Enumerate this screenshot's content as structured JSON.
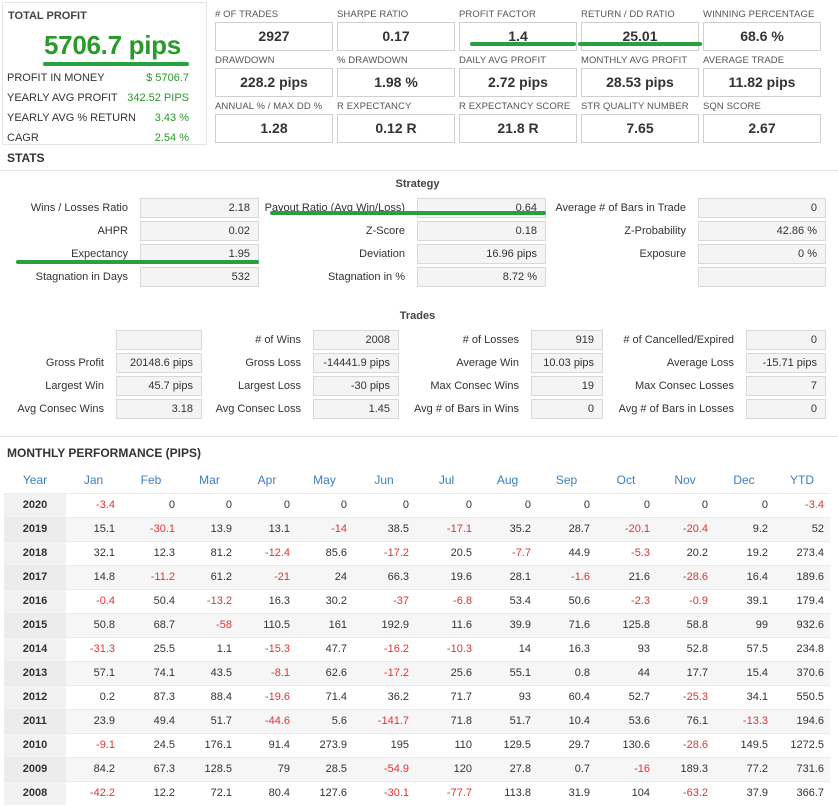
{
  "summary": {
    "total_profit_label": "TOTAL PROFIT",
    "total_profit_value": "5706.7 pips",
    "rows": [
      {
        "label": "PROFIT IN MONEY",
        "value": "$ 5706.7"
      },
      {
        "label": "YEARLY AVG PROFIT",
        "value": "342.52 PIPS"
      },
      {
        "label": "YEARLY AVG % RETURN",
        "value": "3.43 %"
      },
      {
        "label": "CAGR",
        "value": "2.54 %"
      }
    ]
  },
  "metrics": [
    {
      "label": "# OF TRADES",
      "value": "2927"
    },
    {
      "label": "SHARPE RATIO",
      "value": "0.17"
    },
    {
      "label": "PROFIT FACTOR",
      "value": "1.4"
    },
    {
      "label": "RETURN / DD RATIO",
      "value": "25.01"
    },
    {
      "label": "WINNING PERCENTAGE",
      "value": "68.6 %"
    },
    {
      "label": "DRAWDOWN",
      "value": "228.2 pips"
    },
    {
      "label": "% DRAWDOWN",
      "value": "1.98 %"
    },
    {
      "label": "DAILY AVG PROFIT",
      "value": "2.72 pips"
    },
    {
      "label": "MONTHLY AVG PROFIT",
      "value": "28.53 pips"
    },
    {
      "label": "AVERAGE TRADE",
      "value": "11.82 pips"
    },
    {
      "label": "ANNUAL % / MAX DD %",
      "value": "1.28"
    },
    {
      "label": "R EXPECTANCY",
      "value": "0.12 R"
    },
    {
      "label": "R EXPECTANCY SCORE",
      "value": "21.8 R"
    },
    {
      "label": "STR QUALITY NUMBER",
      "value": "7.65"
    },
    {
      "label": "SQN SCORE",
      "value": "2.67"
    }
  ],
  "stats": {
    "title": "STATS",
    "strategy_title": "Strategy",
    "strategy": [
      [
        {
          "label": "Wins / Losses Ratio",
          "value": "2.18"
        },
        {
          "label": "Payout Ratio (Avg Win/Loss)",
          "value": "0.64"
        },
        {
          "label": "Average # of Bars in Trade",
          "value": "0"
        }
      ],
      [
        {
          "label": "AHPR",
          "value": "0.02"
        },
        {
          "label": "Z-Score",
          "value": "0.18"
        },
        {
          "label": "Z-Probability",
          "value": "42.86 %"
        }
      ],
      [
        {
          "label": "Expectancy",
          "value": "1.95"
        },
        {
          "label": "Deviation",
          "value": "16.96 pips"
        },
        {
          "label": "Exposure",
          "value": "0 %"
        }
      ],
      [
        {
          "label": "Stagnation in Days",
          "value": "532"
        },
        {
          "label": "Stagnation in %",
          "value": "8.72 %"
        },
        {
          "label": "",
          "value": ""
        }
      ]
    ],
    "trades_title": "Trades",
    "trades": [
      [
        {
          "label": "",
          "value": ""
        },
        {
          "label": "# of Wins",
          "value": "2008"
        },
        {
          "label": "# of Losses",
          "value": "919"
        },
        {
          "label": "# of Cancelled/Expired",
          "value": "0"
        }
      ],
      [
        {
          "label": "Gross Profit",
          "value": "20148.6 pips"
        },
        {
          "label": "Gross Loss",
          "value": "-14441.9 pips"
        },
        {
          "label": "Average Win",
          "value": "10.03 pips"
        },
        {
          "label": "Average Loss",
          "value": "-15.71 pips"
        }
      ],
      [
        {
          "label": "Largest Win",
          "value": "45.7 pips"
        },
        {
          "label": "Largest Loss",
          "value": "-30 pips"
        },
        {
          "label": "Max Consec Wins",
          "value": "19"
        },
        {
          "label": "Max Consec Losses",
          "value": "7"
        }
      ],
      [
        {
          "label": "Avg Consec Wins",
          "value": "3.18"
        },
        {
          "label": "Avg Consec Loss",
          "value": "1.45"
        },
        {
          "label": "Avg # of Bars in Wins",
          "value": "0"
        },
        {
          "label": "Avg # of Bars in Losses",
          "value": "0"
        }
      ]
    ]
  },
  "monthly": {
    "title": "MONTHLY PERFORMANCE (PIPS)",
    "headers": [
      "Year",
      "Jan",
      "Feb",
      "Mar",
      "Apr",
      "May",
      "Jun",
      "Jul",
      "Aug",
      "Sep",
      "Oct",
      "Nov",
      "Dec",
      "YTD"
    ],
    "rows": [
      [
        "2020",
        "-3.4",
        "0",
        "0",
        "0",
        "0",
        "0",
        "0",
        "0",
        "0",
        "0",
        "0",
        "0",
        "-3.4"
      ],
      [
        "2019",
        "15.1",
        "-30.1",
        "13.9",
        "13.1",
        "-14",
        "38.5",
        "-17.1",
        "35.2",
        "28.7",
        "-20.1",
        "-20.4",
        "9.2",
        "52"
      ],
      [
        "2018",
        "32.1",
        "12.3",
        "81.2",
        "-12.4",
        "85.6",
        "-17.2",
        "20.5",
        "-7.7",
        "44.9",
        "-5.3",
        "20.2",
        "19.2",
        "273.4"
      ],
      [
        "2017",
        "14.8",
        "-11.2",
        "61.2",
        "-21",
        "24",
        "66.3",
        "19.6",
        "28.1",
        "-1.6",
        "21.6",
        "-28.6",
        "16.4",
        "189.6"
      ],
      [
        "2016",
        "-0.4",
        "50.4",
        "-13.2",
        "16.3",
        "30.2",
        "-37",
        "-6.8",
        "53.4",
        "50.6",
        "-2.3",
        "-0.9",
        "39.1",
        "179.4"
      ],
      [
        "2015",
        "50.8",
        "68.7",
        "-58",
        "110.5",
        "161",
        "192.9",
        "11.6",
        "39.9",
        "71.6",
        "125.8",
        "58.8",
        "99",
        "932.6"
      ],
      [
        "2014",
        "-31.3",
        "25.5",
        "1.1",
        "-15.3",
        "47.7",
        "-16.2",
        "-10.3",
        "14",
        "16.3",
        "93",
        "52.8",
        "57.5",
        "234.8"
      ],
      [
        "2013",
        "57.1",
        "74.1",
        "43.5",
        "-8.1",
        "62.6",
        "-17.2",
        "25.6",
        "55.1",
        "0.8",
        "44",
        "17.7",
        "15.4",
        "370.6"
      ],
      [
        "2012",
        "0.2",
        "87.3",
        "88.4",
        "-19.6",
        "71.4",
        "36.2",
        "71.7",
        "93",
        "60.4",
        "52.7",
        "-25.3",
        "34.1",
        "550.5"
      ],
      [
        "2011",
        "23.9",
        "49.4",
        "51.7",
        "-44.6",
        "5.6",
        "-141.7",
        "71.8",
        "51.7",
        "10.4",
        "53.6",
        "76.1",
        "-13.3",
        "194.6"
      ],
      [
        "2010",
        "-9.1",
        "24.5",
        "176.1",
        "91.4",
        "273.9",
        "195",
        "110",
        "129.5",
        "29.7",
        "130.6",
        "-28.6",
        "149.5",
        "1272.5"
      ],
      [
        "2009",
        "84.2",
        "67.3",
        "128.5",
        "79",
        "28.5",
        "-54.9",
        "120",
        "27.8",
        "0.7",
        "-16",
        "189.3",
        "77.2",
        "731.6"
      ],
      [
        "2008",
        "-42.2",
        "12.2",
        "72.1",
        "80.4",
        "127.6",
        "-30.1",
        "-77.7",
        "113.8",
        "31.9",
        "104",
        "-63.2",
        "37.9",
        "366.7"
      ]
    ]
  },
  "colors": {
    "accent_green": "#25a23d",
    "positive_text": "#2a9a2a",
    "negative_text": "#e03333",
    "header_blue": "#3a7fc4"
  }
}
